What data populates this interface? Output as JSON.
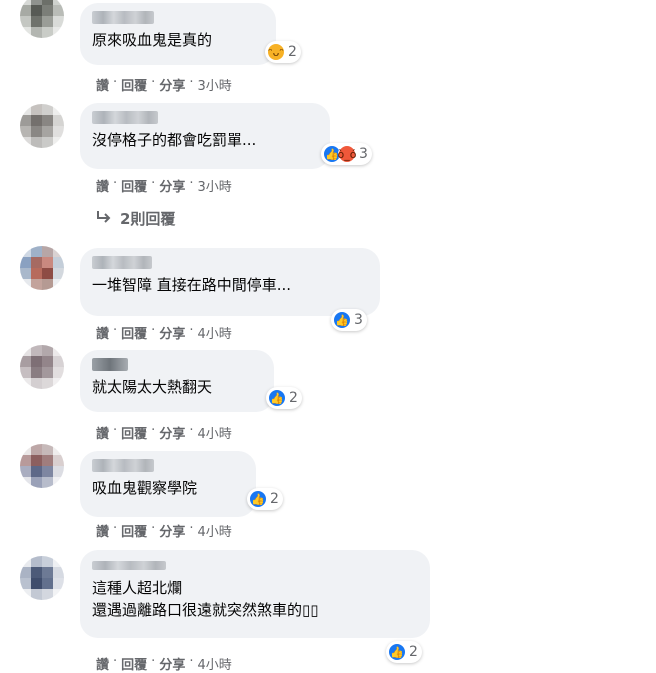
{
  "comments": [
    {
      "text": "原來吸血鬼是真的",
      "reactions": [
        "haha"
      ],
      "count": "2",
      "time": "3小時"
    },
    {
      "text": "沒停格子的都會吃罰單...",
      "reactions": [
        "like",
        "angry"
      ],
      "count": "3",
      "time": "3小時"
    },
    {
      "text": "一堆智障 直接在路中間停車...",
      "reactions": [
        "like"
      ],
      "count": "3",
      "time": "4小時"
    },
    {
      "text": "就太陽太大熱翻天",
      "reactions": [
        "like"
      ],
      "count": "2",
      "time": "4小時"
    },
    {
      "text": "吸血鬼觀察學院",
      "reactions": [
        "like"
      ],
      "count": "2",
      "time": "4小時"
    },
    {
      "text": "這種人超北爛\n還遇過離路口很遠就突然煞車的▯▯",
      "reactions": [
        "like"
      ],
      "count": "2",
      "time": "4小時"
    }
  ],
  "actions": {
    "like": "讚",
    "reply": "回覆",
    "share": "分享",
    "sep": "·"
  },
  "replies_toggle": {
    "label": "2則回覆",
    "icon": "reply-arrow-icon"
  },
  "colors": {
    "bubble": "#f0f2f5",
    "meta": "#65676b",
    "like": "#1877f2",
    "angry": "#f0583a",
    "haha": "#f7b125"
  }
}
